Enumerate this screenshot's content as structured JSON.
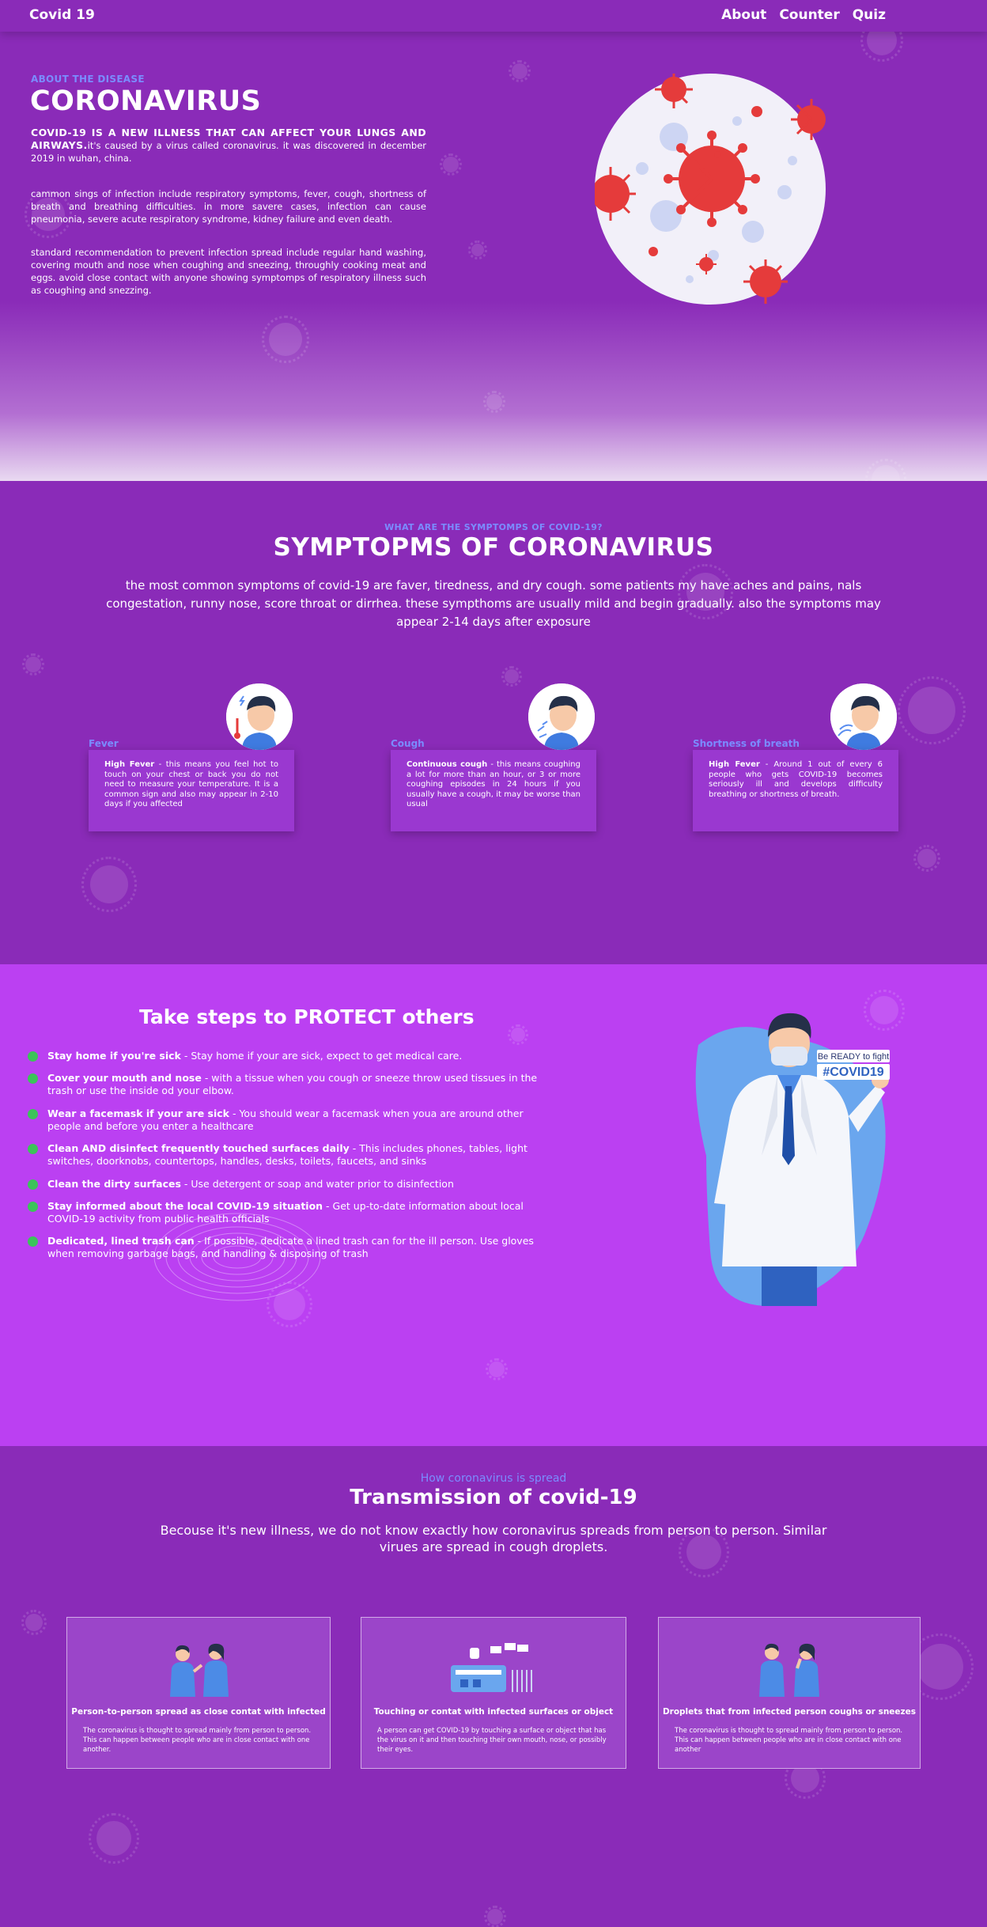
{
  "nav": {
    "brand": "Covid 19",
    "links": [
      "About",
      "Counter",
      "Quiz"
    ]
  },
  "about": {
    "kicker": "ABOUT THE DISEASE",
    "title": "CORONAVIRUS",
    "p1_lead": "COVID-19 IS A NEW ILLNESS THAT CAN AFFECT YOUR LUNGS AND AIRWAYS.",
    "p1_rest": "it's caused by a virus called coronavirus. it was discovered in december 2019 in wuhan, china.",
    "p2": "cammon sings of infection include respiratory symptoms, fever, cough, shortness of breath and breathing difficulties. in more savere cases, infection can cause pneumonia, severe acute respiratory syndrome, kidney failure and even death.",
    "p3": "standard recommendation to prevent infection spread include regular hand washing, covering mouth and nose when coughing and sneezing, throughly cooking meat and eggs. avoid close contact with anyone showing symptomps of respiratory illness such as coughing and snezzing."
  },
  "symptoms": {
    "kicker": "WHAT ARE THE SYMPTOMPS OF COVID-19?",
    "title_light": "SYMPTOPMS OF ",
    "title_bold": "CORONAVIRUS",
    "description": "the most common symptoms of covid-19 are faver, tiredness, and dry cough. some patients my have aches and pains, nals congestation, runny nose, score throat or dirrhea. these sympthoms are usually mild and begin gradually. also the symptoms may appear 2-14 days after exposure",
    "cards": [
      {
        "label": "Fever",
        "lead": "High Fever",
        "text": " - this means you feel hot to touch on your chest or back you do not need to measure your temperature. It is a common sign and also may appear in 2-10 days if you affected"
      },
      {
        "label": "Cough",
        "lead": "Continuous cough",
        "text": " - this means coughing a lot for more than an hour, or 3 or more coughing episodes in 24 hours if you usually have a cough, it may be worse than usual"
      },
      {
        "label": "Shortness of breath",
        "lead": "High Fever",
        "text": " - Around 1 out of every 6 people who gets COVID-19 becomes seriously ill and develops difficulty breathing or shortness of breath."
      }
    ]
  },
  "protect": {
    "title_pre": "Take steps to ",
    "title_bold": "PROTECT",
    "title_post": " others",
    "steps": [
      {
        "lead": "Stay home if you're sick",
        "text": " - Stay home if your are sick, expect to get medical care."
      },
      {
        "lead": "Cover your mouth and nose",
        "text": " - with a tissue when you cough or sneeze throw used tissues in the trash or use the inside od your elbow."
      },
      {
        "lead": "Wear a facemask if your are sick",
        "text": " - You should wear a facemask when youa are around other people and before you enter a healthcare"
      },
      {
        "lead": "Clean AND disinfect frequently touched surfaces daily",
        "text": " - This includes phones, tables, light switches, doorknobs, countertops, handles, desks, toilets, faucets, and sinks"
      },
      {
        "lead": "Clean the dirty surfaces",
        "text": " - Use detergent or soap and water prior to disinfection"
      },
      {
        "lead": "Stay informed about the local COVID-19 situation",
        "text": " - Get up-to-date information about local COVID-19 activity from public health officials"
      },
      {
        "lead": "Dedicated, lined trash can",
        "text": " - If possible, dedicate a lined trash can for the ill person. Use gloves when removing garbage bags, and handling & disposing of trash"
      }
    ],
    "badge_line1": "Be READY to fight",
    "badge_hashtag": "#COVID19"
  },
  "transmission": {
    "kicker": "How coronavirus is spread",
    "title": "Transmission of covid-19",
    "description": "Becouse it's new illness, we do not know exactly how coronavirus spreads from person to person. Similar virues are spread in cough droplets.",
    "cards": [
      {
        "title": "Person-to-person spread as close contat with infected",
        "text": "The coronavirus is thought to spread mainly from person to person. This can happen between people who are in close contact with one another."
      },
      {
        "title": "Touching or contat with infected surfaces or object",
        "text": "A person can get COVID-19 by touching a surface or object that has the virus on it and then touching their own mouth, nose, or possibly their eyes."
      },
      {
        "title": "Droplets that from infected person coughs or sneezes",
        "text": "The coronavirus is thought to spread mainly from person to person. This can happen between people who are in close contact with one another"
      }
    ]
  },
  "colors": {
    "bg_purple": "#8a2bb8",
    "protect_bg": "#bb40f2",
    "accent_blue": "#7b8cff",
    "bullet_green": "#3cc35a",
    "virus_red": "#e53b3b"
  }
}
